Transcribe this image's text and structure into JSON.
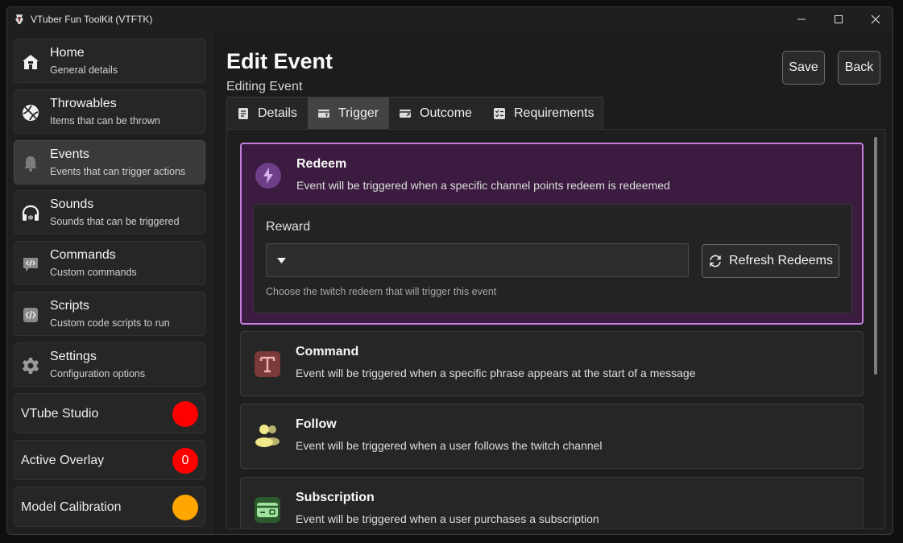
{
  "window": {
    "title": "VTuber Fun ToolKit (VTFTK)"
  },
  "sidebar": {
    "items": [
      {
        "title": "Home",
        "subtitle": "General details",
        "icon": "home-icon"
      },
      {
        "title": "Throwables",
        "subtitle": "Items that can be thrown",
        "icon": "ball-icon"
      },
      {
        "title": "Events",
        "subtitle": "Events that can trigger actions",
        "icon": "bell-icon"
      },
      {
        "title": "Sounds",
        "subtitle": "Sounds that can be triggered",
        "icon": "headphones-icon"
      },
      {
        "title": "Commands",
        "subtitle": "Custom commands",
        "icon": "command-icon"
      },
      {
        "title": "Scripts",
        "subtitle": "Custom code scripts to run",
        "icon": "code-icon"
      },
      {
        "title": "Settings",
        "subtitle": "Configuration options",
        "icon": "gear-icon"
      }
    ],
    "active_index": 2,
    "status": [
      {
        "label": "VTube Studio",
        "value": "",
        "color": "#ff0000"
      },
      {
        "label": "Active Overlay",
        "value": "0",
        "color": "#ff0000"
      },
      {
        "label": "Model Calibration",
        "value": "",
        "color": "#ffa500"
      }
    ]
  },
  "header": {
    "title": "Edit Event",
    "subtitle": "Editing Event",
    "save_label": "Save",
    "back_label": "Back"
  },
  "tabs": [
    {
      "label": "Details",
      "icon": "document-icon"
    },
    {
      "label": "Trigger",
      "icon": "trigger-icon"
    },
    {
      "label": "Outcome",
      "icon": "outcome-icon"
    },
    {
      "label": "Requirements",
      "icon": "checklist-icon"
    }
  ],
  "active_tab": "Trigger",
  "triggers": {
    "redeem": {
      "title": "Redeem",
      "description": "Event will be triggered when a specific channel points redeem is redeemed",
      "icon": "lightning-icon"
    },
    "command": {
      "title": "Command",
      "description": "Event will be triggered when a specific phrase appears at the start of a message",
      "icon": "text-icon"
    },
    "follow": {
      "title": "Follow",
      "description": "Event will be triggered when a user follows the twitch channel",
      "icon": "users-icon"
    },
    "subscription": {
      "title": "Subscription",
      "description": "Event will be triggered when a user purchases a subscription",
      "icon": "card-icon"
    }
  },
  "reward": {
    "label": "Reward",
    "value": "",
    "refresh_label": "Refresh Redeems",
    "hint": "Choose the twitch redeem that will trigger this event"
  },
  "colors": {
    "selected_border": "#c27fdc",
    "selected_bg": "#3b1b3f",
    "status_red": "#ff0000",
    "status_orange": "#ffa500"
  }
}
